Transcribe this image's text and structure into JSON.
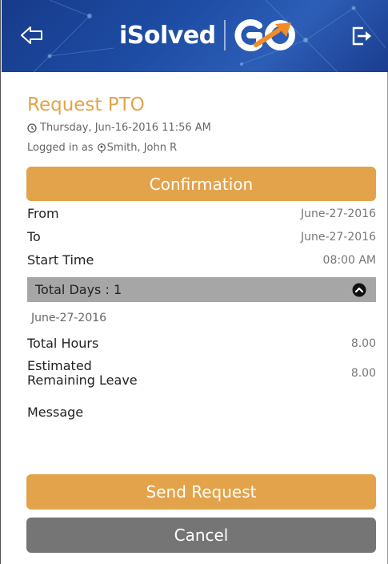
{
  "header": {
    "logo_text": "iSolved",
    "logo_mark": "GO",
    "back_icon": "back-arrow-icon",
    "exit_icon": "logout-icon",
    "colors": {
      "bar": "#1e4ea6",
      "accent": "#f28c28"
    }
  },
  "page": {
    "title": "Request PTO",
    "timestamp": "Thursday, Jun-16-2016 11:56 AM",
    "logged_in_prefix": "Logged in as",
    "user_name": "Smith, John R"
  },
  "confirmation_label": "Confirmation",
  "details": {
    "from_label": "From",
    "from_value": "June-27-2016",
    "to_label": "To",
    "to_value": "June-27-2016",
    "start_time_label": "Start Time",
    "start_time_value": "08:00 AM",
    "total_days_label": "Total Days : 1",
    "day_entry": "June-27-2016",
    "total_hours_label": "Total Hours",
    "total_hours_value": "8.00",
    "remaining_label_line1": "Estimated",
    "remaining_label_line2": "Remaining Leave",
    "remaining_value": "8.00",
    "message_label": "Message"
  },
  "actions": {
    "send_label": "Send Request",
    "cancel_label": "Cancel"
  },
  "colors": {
    "accent": "#e3a34a",
    "cancel": "#757575",
    "section": "#a6a6a6"
  }
}
